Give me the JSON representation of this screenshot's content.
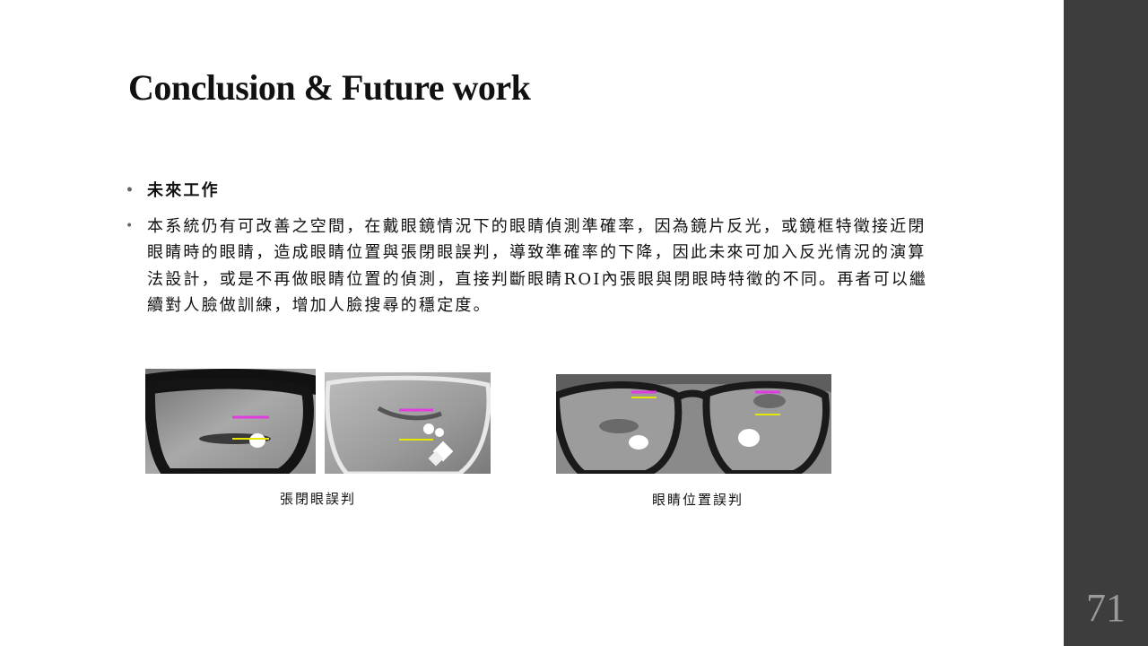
{
  "slide": {
    "title": "Conclusion & Future work",
    "page_number": "71",
    "bullets": [
      "未來工作",
      "本系統仍有可改善之空間，在戴眼鏡情況下的眼睛偵測準確率，因為鏡片反光，或鏡框特徵接近閉眼睛時的眼睛，造成眼睛位置與張閉眼誤判，導致準確率的下降，因此未來可加入反光情況的演算法設計，或是不再做眼睛位置的偵測，直接判斷眼睛ROI內張眼與閉眼時特徵的不同。再者可以繼續對人臉做訓練，增加人臉搜尋的穩定度。"
    ],
    "bullet_marker": "•"
  },
  "figures": {
    "left_caption": "張閉眼誤判",
    "right_caption": "眼睛位置誤判"
  },
  "colors": {
    "sidebar": "#3d3d3d",
    "page_number": "#9a9a9a",
    "marker_magenta": "#e03ce0",
    "marker_yellow": "#e6e600"
  }
}
